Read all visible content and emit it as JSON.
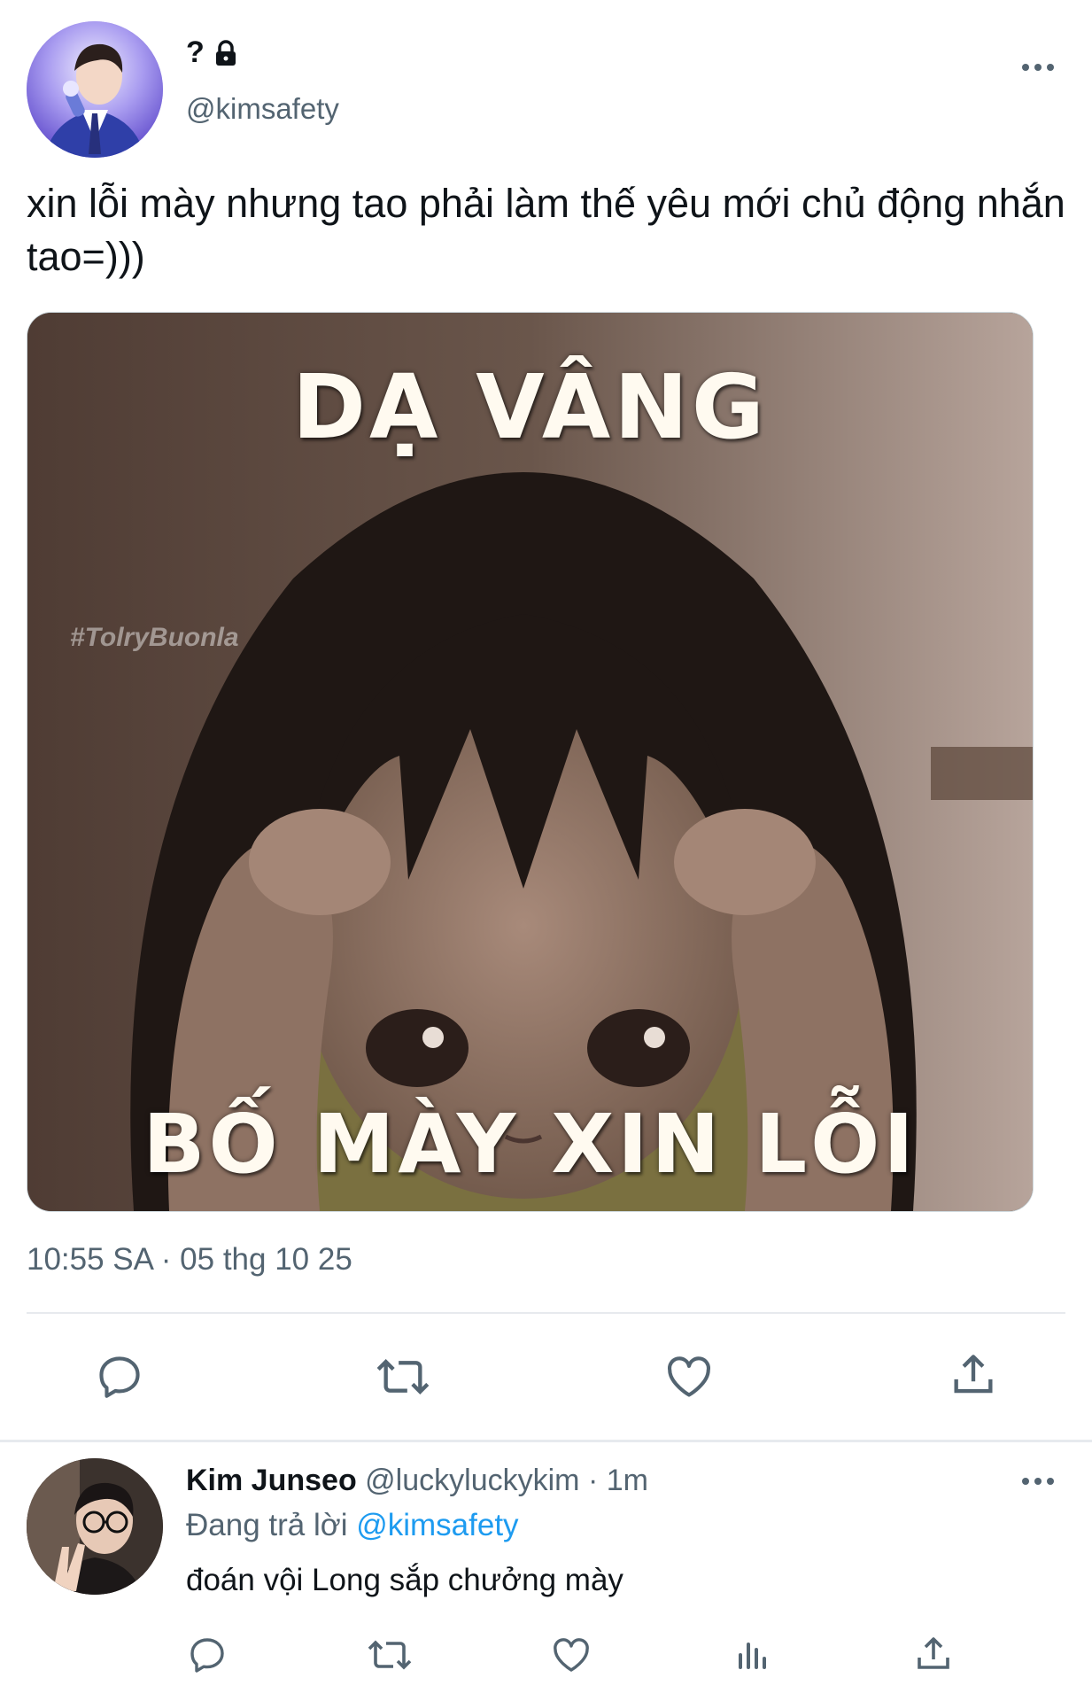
{
  "tweet": {
    "display_name": "?",
    "handle": "@kimsafety",
    "text": "xin lỗi mày nhưng tao phải làm thế yêu mới chủ động nhắn tao=)))",
    "media": {
      "top_caption": "DẠ VÂNG",
      "bottom_caption": "BỐ MÀY XIN LỖI",
      "watermark": "#TolryBuonla"
    },
    "timestamp": "10:55 SA · 05 thg 10 25",
    "actions": [
      "reply-icon",
      "retweet-icon",
      "like-icon",
      "share-icon"
    ]
  },
  "reply": {
    "display_name": "Kim Junseo",
    "handle": "@luckyluckykim",
    "time": "· 1m",
    "replying_label": "Đang trả lời",
    "replying_to": "@kimsafety",
    "text": "đoán vội Long sắp chưởng mày",
    "actions": [
      "reply-icon",
      "retweet-icon",
      "like-icon",
      "analytics-icon",
      "share-icon"
    ]
  },
  "colors": {
    "text": "#0f1419",
    "secondary": "#536471",
    "link": "#1d9bf0",
    "divider": "#e7eaee"
  }
}
